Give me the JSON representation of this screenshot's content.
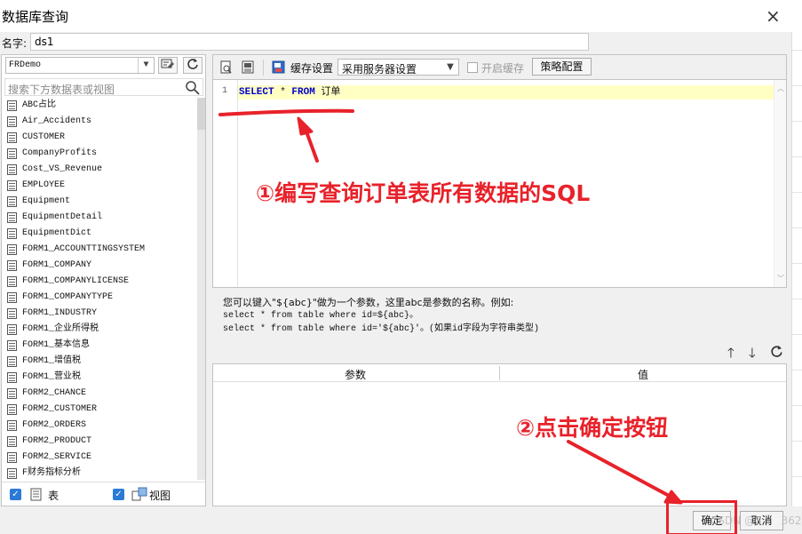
{
  "window": {
    "title": "数据库查询",
    "close_glyph": "×"
  },
  "name_field": {
    "label": "名字:",
    "value": "ds1"
  },
  "left_panel": {
    "connection": "FRDemo",
    "search_placeholder": "搜索下方数据表或视图",
    "tables": [
      "ABC占比",
      "Air_Accidents",
      "CUSTOMER",
      "CompanyProfits",
      "Cost_VS_Revenue",
      "EMPLOYEE",
      "Equipment",
      "EquipmentDetail",
      "EquipmentDict",
      "FORM1_ACCOUNTTINGSYSTEM",
      "FORM1_COMPANY",
      "FORM1_COMPANYLICENSE",
      "FORM1_COMPANYTYPE",
      "FORM1_INDUSTRY",
      "FORM1_企业所得税",
      "FORM1_基本信息",
      "FORM1_增值税",
      "FORM1_营业税",
      "FORM2_CHANCE",
      "FORM2_CUSTOMER",
      "FORM2_ORDERS",
      "FORM2_PRODUCT",
      "FORM2_SERVICE",
      "F财务指标分析"
    ],
    "footer": {
      "table_label": "表",
      "view_label": "视图"
    }
  },
  "toolbar": {
    "cache_label": "缓存设置",
    "cache_value": "采用服务器设置",
    "enable_cache_label": "开启缓存",
    "strategy_button": "策略配置"
  },
  "editor": {
    "line_number": "1",
    "sql": {
      "kw1": "SELECT",
      "star": " * ",
      "kw2": "FROM",
      "table": " 订单"
    }
  },
  "hint": {
    "line1": "您可以键入\"${abc}\"做为一个参数，这里abc是参数的名称。例如:",
    "line2": "select * from table where id=${abc}。",
    "line3": "select * from table where id='${abc}'。(如果id字段为字符串类型)"
  },
  "param_table": {
    "col_param": "参数",
    "col_value": "值"
  },
  "buttons": {
    "ok": "确定",
    "cancel": "取消"
  },
  "watermark": "CSDN @S",
  "watermark_tail": "362",
  "annotations": {
    "step1": "①编写查询订单表所有数据的SQL",
    "step2": "②点击确定按钮",
    "color": "#e8222a"
  }
}
